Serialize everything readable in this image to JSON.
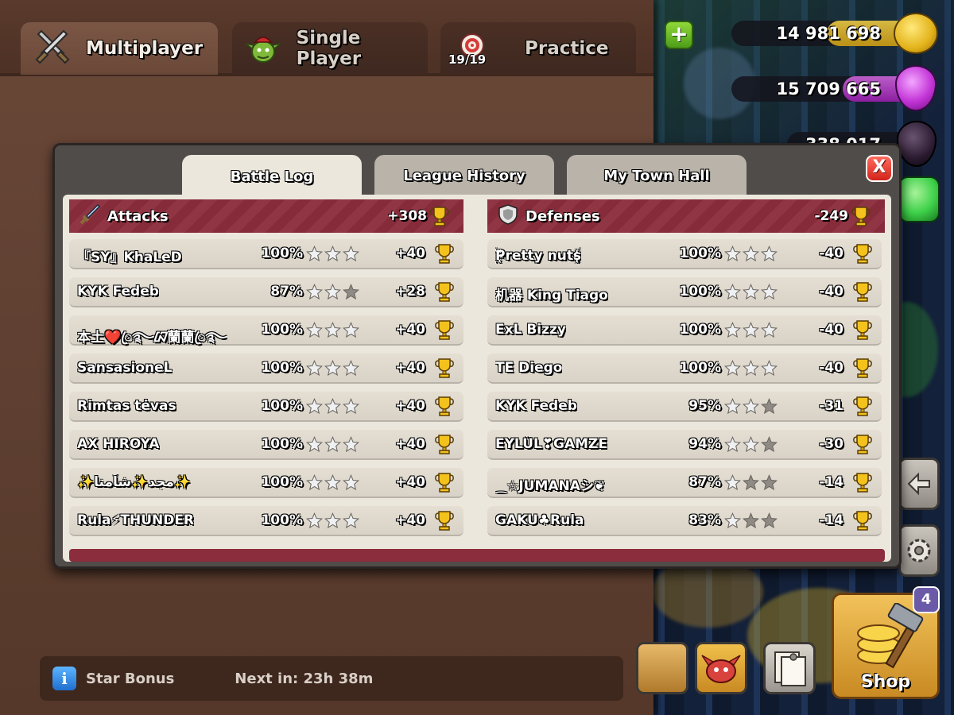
{
  "main_tabs": [
    {
      "label": "Multiplayer",
      "icon": "crossed-swords-icon",
      "active": true
    },
    {
      "label": "Single Player",
      "icon": "goblin-icon",
      "active": false
    },
    {
      "label": "Practice",
      "icon": "target-icon",
      "active": false,
      "count": "19/19"
    }
  ],
  "resources": {
    "gold": "14 981 698",
    "elixir": "15 709 665",
    "dark_elixir_partial": "338 017",
    "colors": {
      "gold": "#f2c31c",
      "elixir": "#c234d6",
      "dark_elixir": "#2a1a30",
      "gem": "#3fd14a"
    }
  },
  "modal": {
    "tabs": [
      {
        "label": "Battle Log",
        "active": true
      },
      {
        "label": "League History",
        "active": false
      },
      {
        "label": "My Town Hall",
        "active": false
      }
    ],
    "close_label": "X",
    "attacks": {
      "header": "Attacks",
      "total": "+308",
      "rows": [
        {
          "name": "『SY』KhaLeD",
          "percent": "100%",
          "stars": 3,
          "trophies": "+40"
        },
        {
          "name": "KYK Fedeb",
          "percent": "87%",
          "stars": 2,
          "trophies": "+28"
        },
        {
          "name": "本土❤️ꦿ࿐ᮘ蘭蘭ꦿ࿐",
          "percent": "100%",
          "stars": 3,
          "trophies": "+40"
        },
        {
          "name": "SansasioneL",
          "percent": "100%",
          "stars": 3,
          "trophies": "+40"
        },
        {
          "name": "Rimtas tėvas",
          "percent": "100%",
          "stars": 3,
          "trophies": "+40"
        },
        {
          "name": "AX HIROYA",
          "percent": "100%",
          "stars": 3,
          "trophies": "+40"
        },
        {
          "name": "✨مجد✨شاًمنا✨",
          "percent": "100%",
          "stars": 3,
          "trophies": "+40"
        },
        {
          "name": "Rula⚡THUNDER",
          "percent": "100%",
          "stars": 3,
          "trophies": "+40"
        }
      ]
    },
    "defenses": {
      "header": "Defenses",
      "total": "-249",
      "rows": [
        {
          "name": "꙰Pretty nuts꙰",
          "percent": "100%",
          "stars": 3,
          "trophies": "-40"
        },
        {
          "name": "机器 King Tiago",
          "percent": "100%",
          "stars": 3,
          "trophies": "-40"
        },
        {
          "name": "ExL Bizzy",
          "percent": "100%",
          "stars": 3,
          "trophies": "-40"
        },
        {
          "name": "TE Diego",
          "percent": "100%",
          "stars": 3,
          "trophies": "-40"
        },
        {
          "name": "KYK Fedeb",
          "percent": "95%",
          "stars": 2,
          "trophies": "-31"
        },
        {
          "name": "EYLÜL❣GAMZE",
          "percent": "94%",
          "stars": 2,
          "trophies": "-30"
        },
        {
          "name": "⁔☆JUMANAシ❦",
          "percent": "87%",
          "stars": 1,
          "trophies": "-14"
        },
        {
          "name": "GAKU♣Rula",
          "percent": "83%",
          "stars": 1,
          "trophies": "-14"
        }
      ]
    }
  },
  "star_bonus": {
    "label": "Star Bonus",
    "next_label": "Next in: 23h 38m"
  },
  "shop": {
    "label": "Shop",
    "badge": "4"
  }
}
